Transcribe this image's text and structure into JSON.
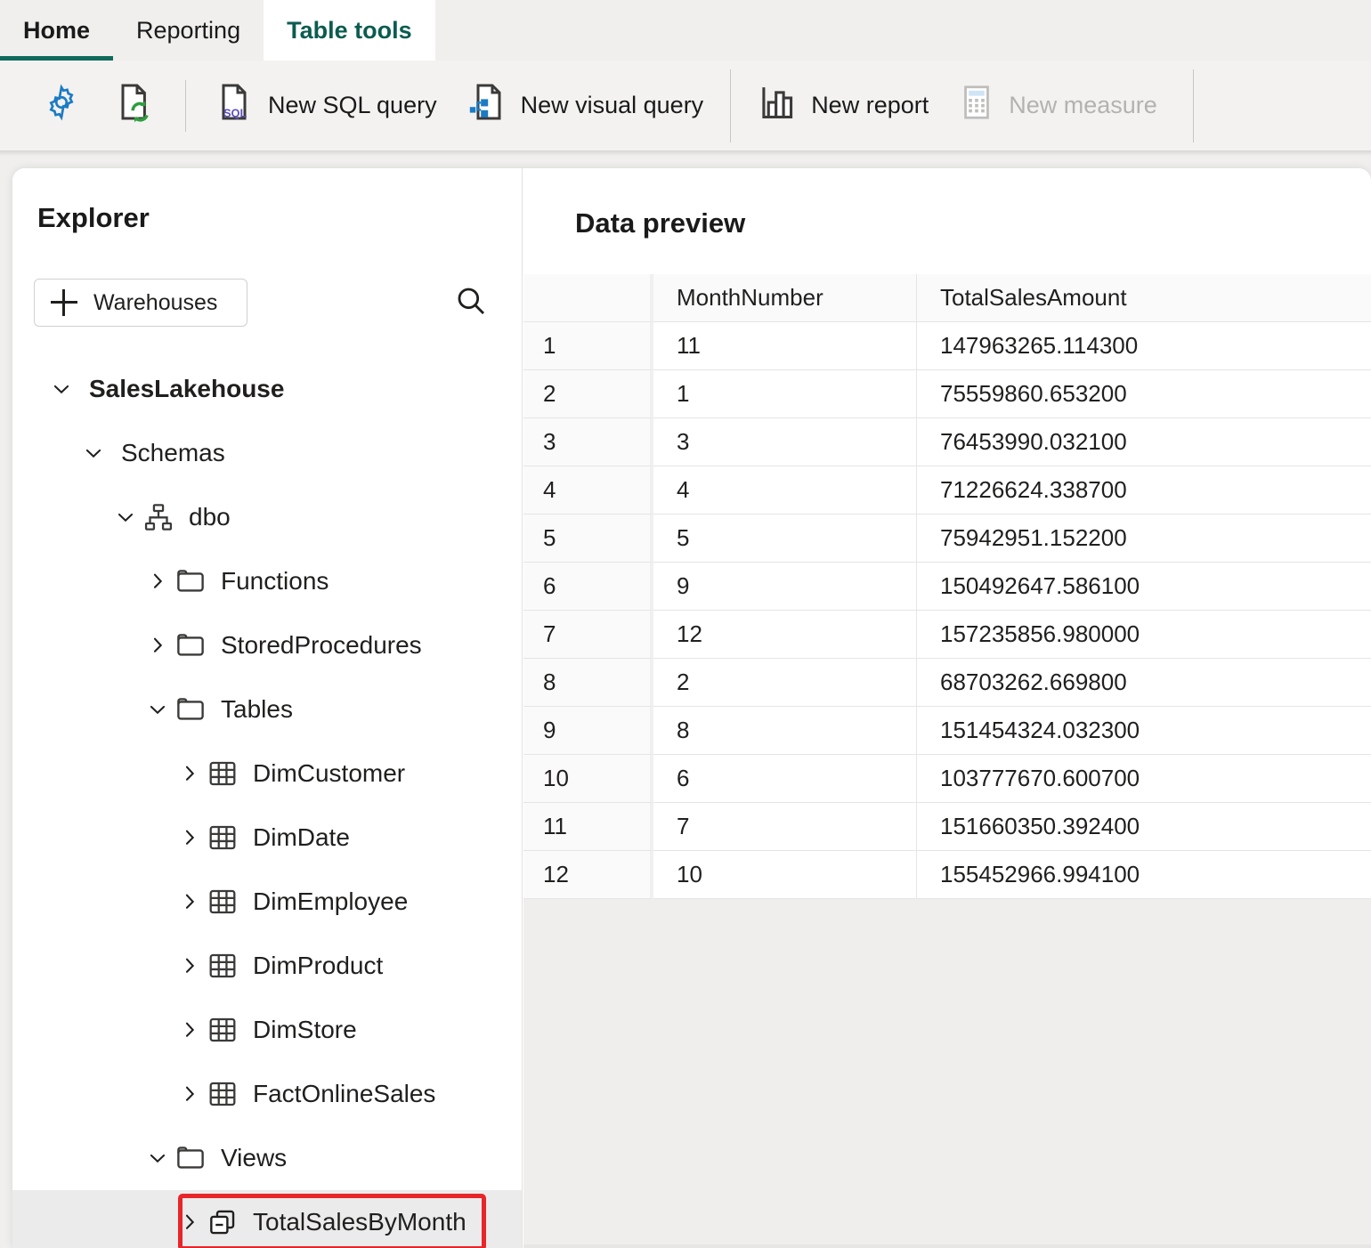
{
  "ribbon": {
    "tabs": [
      {
        "label": "Home",
        "state": "underlined"
      },
      {
        "label": "Reporting",
        "state": "normal"
      },
      {
        "label": "Table tools",
        "state": "selected"
      }
    ],
    "commands": [
      {
        "label": "",
        "icon": "settings-gear-icon",
        "enabled": true
      },
      {
        "label": "",
        "icon": "refresh-document-icon",
        "enabled": true
      },
      {
        "label": "New SQL query",
        "icon": "sql-document-icon",
        "enabled": true
      },
      {
        "label": "New visual query",
        "icon": "visual-query-document-icon",
        "enabled": true
      },
      {
        "label": "New report",
        "icon": "bar-chart-icon",
        "enabled": true
      },
      {
        "label": "New measure",
        "icon": "calculator-icon",
        "enabled": false
      }
    ]
  },
  "explorer": {
    "title": "Explorer",
    "add_button_label": "Warehouses",
    "search_icon": "search-icon",
    "tree": [
      {
        "label": "SalesLakehouse",
        "depth": 0,
        "icon": "none",
        "chevron": "down",
        "bold": true,
        "selected": false
      },
      {
        "label": "Schemas",
        "depth": 1,
        "icon": "none",
        "chevron": "down",
        "bold": false,
        "selected": false
      },
      {
        "label": "dbo",
        "depth": 2,
        "icon": "schema-icon",
        "chevron": "down",
        "bold": false,
        "selected": false
      },
      {
        "label": "Functions",
        "depth": 3,
        "icon": "folder-icon",
        "chevron": "right",
        "bold": false,
        "selected": false
      },
      {
        "label": "StoredProcedures",
        "depth": 3,
        "icon": "folder-icon",
        "chevron": "right",
        "bold": false,
        "selected": false
      },
      {
        "label": "Tables",
        "depth": 3,
        "icon": "folder-icon",
        "chevron": "down",
        "bold": false,
        "selected": false
      },
      {
        "label": "DimCustomer",
        "depth": 4,
        "icon": "table-icon",
        "chevron": "right",
        "bold": false,
        "selected": false
      },
      {
        "label": "DimDate",
        "depth": 4,
        "icon": "table-icon",
        "chevron": "right",
        "bold": false,
        "selected": false
      },
      {
        "label": "DimEmployee",
        "depth": 4,
        "icon": "table-icon",
        "chevron": "right",
        "bold": false,
        "selected": false
      },
      {
        "label": "DimProduct",
        "depth": 4,
        "icon": "table-icon",
        "chevron": "right",
        "bold": false,
        "selected": false
      },
      {
        "label": "DimStore",
        "depth": 4,
        "icon": "table-icon",
        "chevron": "right",
        "bold": false,
        "selected": false
      },
      {
        "label": "FactOnlineSales",
        "depth": 4,
        "icon": "table-icon",
        "chevron": "right",
        "bold": false,
        "selected": false
      },
      {
        "label": "Views",
        "depth": 3,
        "icon": "folder-icon",
        "chevron": "down",
        "bold": false,
        "selected": false
      },
      {
        "label": "TotalSalesByMonth",
        "depth": 4,
        "icon": "view-icon",
        "chevron": "right",
        "bold": false,
        "selected": true,
        "highlighted": true
      }
    ]
  },
  "preview": {
    "title": "Data preview",
    "columns": [
      "",
      "MonthNumber",
      "TotalSalesAmount"
    ],
    "rows": [
      {
        "index": "1",
        "MonthNumber": "11",
        "TotalSalesAmount": "147963265.114300"
      },
      {
        "index": "2",
        "MonthNumber": "1",
        "TotalSalesAmount": "75559860.653200"
      },
      {
        "index": "3",
        "MonthNumber": "3",
        "TotalSalesAmount": "76453990.032100"
      },
      {
        "index": "4",
        "MonthNumber": "4",
        "TotalSalesAmount": "71226624.338700"
      },
      {
        "index": "5",
        "MonthNumber": "5",
        "TotalSalesAmount": "75942951.152200"
      },
      {
        "index": "6",
        "MonthNumber": "9",
        "TotalSalesAmount": "150492647.586100"
      },
      {
        "index": "7",
        "MonthNumber": "12",
        "TotalSalesAmount": "157235856.980000"
      },
      {
        "index": "8",
        "MonthNumber": "2",
        "TotalSalesAmount": "68703262.669800"
      },
      {
        "index": "9",
        "MonthNumber": "8",
        "TotalSalesAmount": "151454324.032300"
      },
      {
        "index": "10",
        "MonthNumber": "6",
        "TotalSalesAmount": "103777670.600700"
      },
      {
        "index": "11",
        "MonthNumber": "7",
        "TotalSalesAmount": "151660350.392400"
      },
      {
        "index": "12",
        "MonthNumber": "10",
        "TotalSalesAmount": "155452966.994100"
      }
    ]
  },
  "colors": {
    "accent_teal": "#0f6b5c",
    "highlight_red": "#e8252a",
    "icon_blue": "#1b7bc4",
    "icon_green": "#2e9e3e",
    "selected_row_bg": "#ebebeb",
    "ribbon_bg": "#f3f2f1",
    "page_bg": "#f0efee"
  }
}
